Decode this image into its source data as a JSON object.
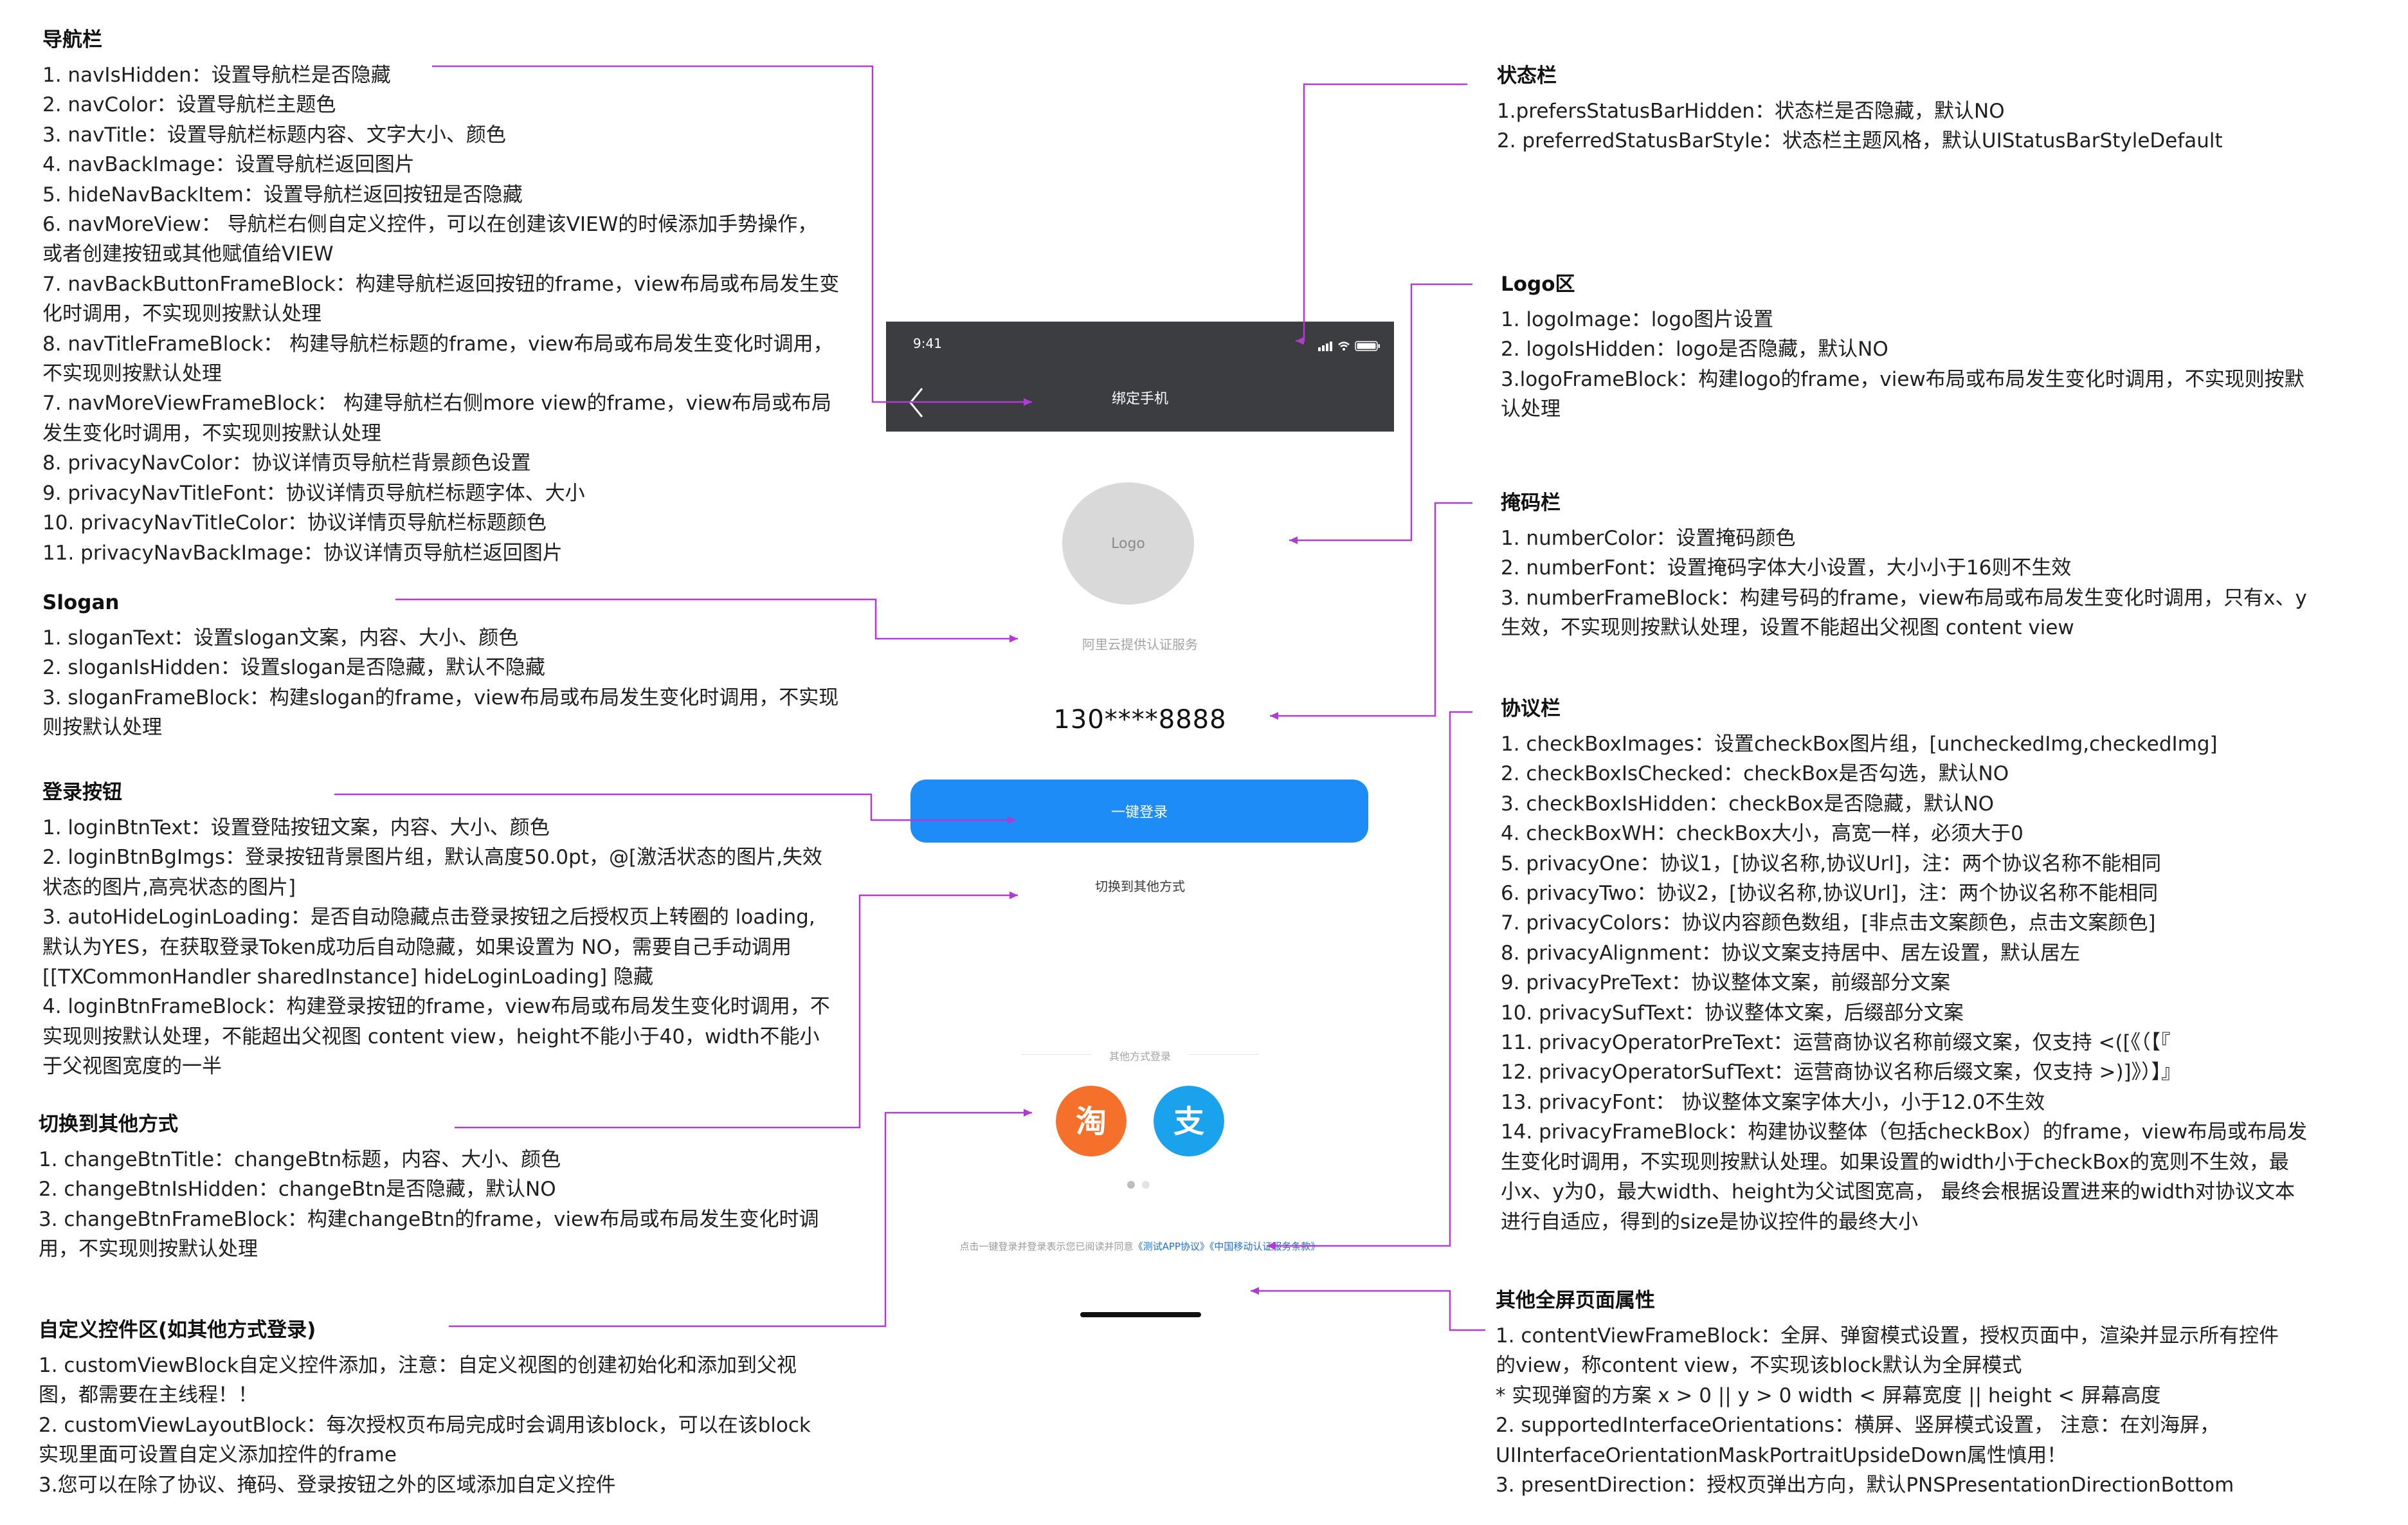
{
  "sections": {
    "nav": {
      "title": "导航栏",
      "items": [
        "1. navIsHidden：设置导航栏是否隐藏",
        "2. navColor：设置导航栏主题色",
        "3. navTitle：设置导航栏标题内容、文字大小、颜色",
        "4. navBackImage：设置导航栏返回图片",
        "5. hideNavBackItem：设置导航栏返回按钮是否隐藏",
        "6. navMoreView： 导航栏右侧自定义控件，可以在创建该VIEW的时候添加手势操作，",
        "或者创建按钮或其他赋值给VIEW",
        "7. navBackButtonFrameBlock：构建导航栏返回按钮的frame，view布局或布局发生变",
        "化时调用，不实现则按默认处理",
        "8. navTitleFrameBlock： 构建导航栏标题的frame，view布局或布局发生变化时调用，",
        "不实现则按默认处理",
        "7. navMoreViewFrameBlock： 构建导航栏右侧more view的frame，view布局或布局",
        "发生变化时调用，不实现则按默认处理",
        "8. privacyNavColor：协议详情页导航栏背景颜色设置",
        "9. privacyNavTitleFont：协议详情页导航栏标题字体、大小",
        "10. privacyNavTitleColor：协议详情页导航栏标题颜色",
        "11. privacyNavBackImage：协议详情页导航栏返回图片"
      ]
    },
    "slogan": {
      "title": "Slogan",
      "items": [
        "1. sloganText：设置slogan文案，内容、大小、颜色",
        "2. sloganIsHidden：设置slogan是否隐藏，默认不隐藏",
        "3. sloganFrameBlock：构建slogan的frame，view布局或布局发生变化时调用，不实现",
        "则按默认处理"
      ]
    },
    "login": {
      "title": "登录按钮",
      "items": [
        "1. loginBtnText：设置登陆按钮文案，内容、大小、颜色",
        "2. loginBtnBgImgs：登录按钮背景图片组，默认高度50.0pt，@[激活状态的图片,失效",
        "状态的图片,高亮状态的图片]",
        "3. autoHideLoginLoading：是否自动隐藏点击登录按钮之后授权页上转圈的 loading,",
        "默认为YES，在获取登录Token成功后自动隐藏，如果设置为 NO，需要自己手动调用",
        "[[TXCommonHandler sharedInstance] hideLoginLoading] 隐藏",
        "4. loginBtnFrameBlock：构建登录按钮的frame，view布局或布局发生变化时调用，不",
        "实现则按默认处理，不能超出父视图 content view，height不能小于40，width不能小",
        "于父视图宽度的一半"
      ]
    },
    "change": {
      "title": "切换到其他方式",
      "items": [
        "1. changeBtnTitle：changeBtn标题，内容、大小、颜色",
        "2. changeBtnIsHidden：changeBtn是否隐藏，默认NO",
        "3. changeBtnFrameBlock：构建changeBtn的frame，view布局或布局发生变化时调",
        "用，不实现则按默认处理"
      ]
    },
    "custom": {
      "title": "自定义控件区(如其他方式登录)",
      "items": [
        "1. customViewBlock自定义控件添加，注意：自定义视图的创建初始化和添加到父视",
        "图，都需要在主线程！！",
        "2. customViewLayoutBlock：每次授权页布局完成时会调用该block，可以在该block",
        "实现里面可设置自定义添加控件的frame",
        "3.您可以在除了协议、掩码、登录按钮之外的区域添加自定义控件"
      ]
    },
    "status": {
      "title": "状态栏",
      "items": [
        "1.prefersStatusBarHidden：状态栏是否隐藏，默认NO",
        "2. preferredStatusBarStyle：状态栏主题风格，默认UIStatusBarStyleDefault"
      ]
    },
    "logo": {
      "title": "Logo区",
      "items": [
        "1. logoImage：logo图片设置",
        "2. logoIsHidden：logo是否隐藏，默认NO",
        "3.logoFrameBlock：构建logo的frame，view布局或布局发生变化时调用，不实现则按默",
        "认处理"
      ]
    },
    "mask": {
      "title": "掩码栏",
      "items": [
        "1. numberColor：设置掩码颜色",
        "2. numberFont：设置掩码字体大小设置，大小小于16则不生效",
        "3. numberFrameBlock：构建号码的frame，view布局或布局发生变化时调用，只有x、y",
        "生效，不实现则按默认处理，设置不能超出父视图 content view"
      ]
    },
    "privacy": {
      "title": "协议栏",
      "items": [
        "1. checkBoxImages：设置checkBox图片组，[uncheckedImg,checkedImg]",
        "2. checkBoxIsChecked：checkBox是否勾选，默认NO",
        "3. checkBoxIsHidden：checkBox是否隐藏，默认NO",
        "4. checkBoxWH：checkBox大小，高宽一样，必须大于0",
        "5. privacyOne：协议1，[协议名称,协议Url]，注：两个协议名称不能相同",
        "6. privacyTwo：协议2，[协议名称,协议Url]，注：两个协议名称不能相同",
        "7. privacyColors：协议内容颜色数组，[非点击文案颜色，点击文案颜色]",
        "8. privacyAlignment：协议文案支持居中、居左设置，默认居左",
        "9. privacyPreText：协议整体文案，前缀部分文案",
        "10. privacySufText：协议整体文案，后缀部分文案",
        "11. privacyOperatorPreText：运营商协议名称前缀文案，仅支持 <([《（【『",
        "12. privacyOperatorSufText：运营商协议名称后缀文案，仅支持 >)]》）】』",
        "13. privacyFont： 协议整体文案字体大小，小于12.0不生效",
        "14. privacyFrameBlock：构建协议整体（包括checkBox）的frame，view布局或布局发",
        "生变化时调用，不实现则按默认处理。如果设置的width小于checkBox的宽则不生效，最",
        "小x、y为0，最大width、height为父试图宽高， 最终会根据设置进来的width对协议文本",
        "进行自适应，得到的size是协议控件的最终大小"
      ]
    },
    "fullscreen": {
      "title": "其他全屏页面属性",
      "items": [
        "1. contentViewFrameBlock：全屏、弹窗模式设置，授权页面中，渲染并显示所有控件",
        "的view，称content view，不实现该block默认为全屏模式",
        "* 实现弹窗的方案 x > 0 || y > 0 width < 屏幕宽度 || height < 屏幕高度",
        "2. supportedInterfaceOrientations：横屏、竖屏模式设置， 注意：在刘海屏，",
        "UIInterfaceOrientationMaskPortraitUpsideDown属性慎用！",
        "3. presentDirection：授权页弹出方向，默认PNSPresentationDirectionBottom"
      ]
    }
  },
  "phone": {
    "status_time": "9:41",
    "nav_title": "绑定手机",
    "logo_text": "Logo",
    "slogan": "阿里云提供认证服务",
    "number": "130****8888",
    "login_button": "一键登录",
    "change_button": "切换到其他方式",
    "other_login_label": "其他方式登录",
    "taobao_glyph": "淘",
    "alipay_glyph": "支",
    "privacy_pre": "点击一键登录并登录表示您已阅读并同意",
    "privacy_link1": "《测试APP协议》",
    "privacy_link2": "《中国移动认证服务条款》"
  },
  "colors": {
    "accent_line": "#b03bd3",
    "nav_bg": "#3c3d40",
    "login_btn": "#1d8cf6",
    "taobao": "#f5702a",
    "alipay": "#1aa3ec",
    "logo_bg": "#d9d9d9"
  },
  "icons": [
    "back-chevron-icon",
    "signal-icon",
    "wifi-icon",
    "battery-icon",
    "taobao-icon",
    "alipay-icon"
  ]
}
